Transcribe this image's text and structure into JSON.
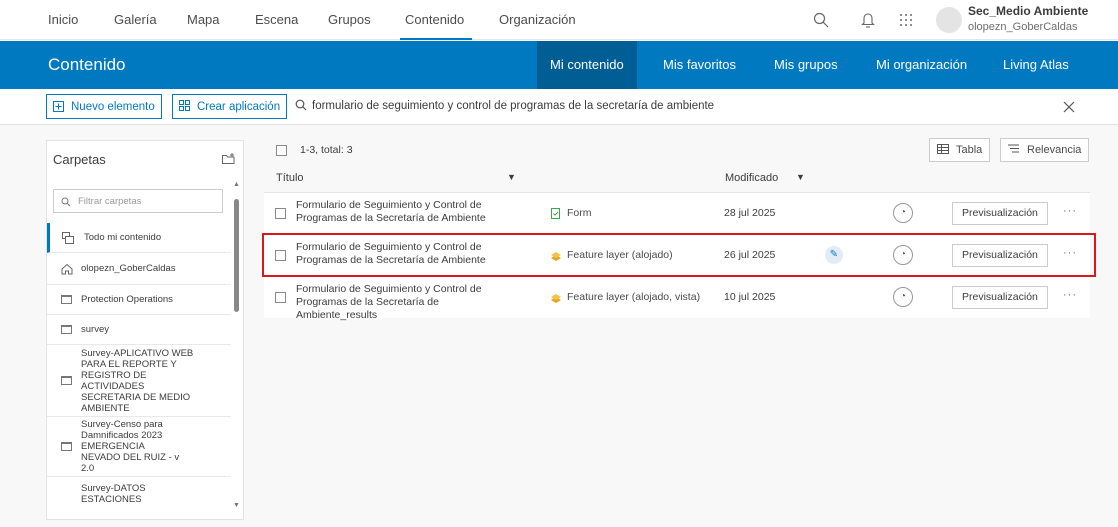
{
  "topnav": {
    "items": [
      "Inicio",
      "Galería",
      "Mapa",
      "Escena",
      "Grupos",
      "Contenido",
      "Organización"
    ],
    "active": "Contenido",
    "user_name": "Sec_Medio Ambiente",
    "user_login": "olopezn_GoberCaldas",
    "icons": [
      "search-icon",
      "bell-icon",
      "app-launcher-icon",
      "avatar"
    ]
  },
  "content_bar": {
    "title": "Contenido",
    "tabs": [
      "Mi contenido",
      "Mis favoritos",
      "Mis grupos",
      "Mi organización",
      "Living Atlas"
    ],
    "active_tab": "Mi contenido"
  },
  "actions": {
    "new_item": "Nuevo elemento",
    "create_app": "Crear aplicación",
    "search_query": "formulario de seguimiento y control de programas de la secretaría de ambiente"
  },
  "folders": {
    "heading": "Carpetas",
    "filter_placeholder": "Filtrar carpetas",
    "items": [
      {
        "label": "Todo mi contenido"
      },
      {
        "label": "olopezn_GoberCaldas"
      },
      {
        "label": "Protection Operations"
      },
      {
        "label": "survey"
      },
      {
        "label": "Survey-APLICATIVO WEB PARA EL REPORTE Y REGISTRO DE ACTIVIDADES SECRETARIA DE MEDIO AMBIENTE"
      },
      {
        "label": "Survey-Censo para Damnificados 2023 EMERGENCIA NEVADO DEL RUIZ - v 2.0"
      },
      {
        "label": "Survey-DATOS ESTACIONES"
      }
    ]
  },
  "results": {
    "count": "1-3, total: 3",
    "view_button": "Tabla",
    "sort_button": "Relevancia",
    "col_title": "Título",
    "col_modified": "Modificado",
    "preview_label": "Previsualización",
    "more_label": "···",
    "rows": [
      {
        "title": "Formulario de Seguimiento y Control de Programas de la Secretaría de Ambiente",
        "type": "Form",
        "date": "28 jul 2025"
      },
      {
        "title": "Formulario de Seguimiento y Control de Programas de la Secretaría de Ambiente",
        "type": "Feature layer (alojado)",
        "date": "26 jul 2025"
      },
      {
        "title": "Formulario de Seguimiento y Control de Programas de la Secretaría de Ambiente_results",
        "type": "Feature layer (alojado, vista)",
        "date": "10 jul 2025"
      }
    ]
  },
  "colors": {
    "accent": "#0079c1",
    "highlight": "#d7191c"
  }
}
